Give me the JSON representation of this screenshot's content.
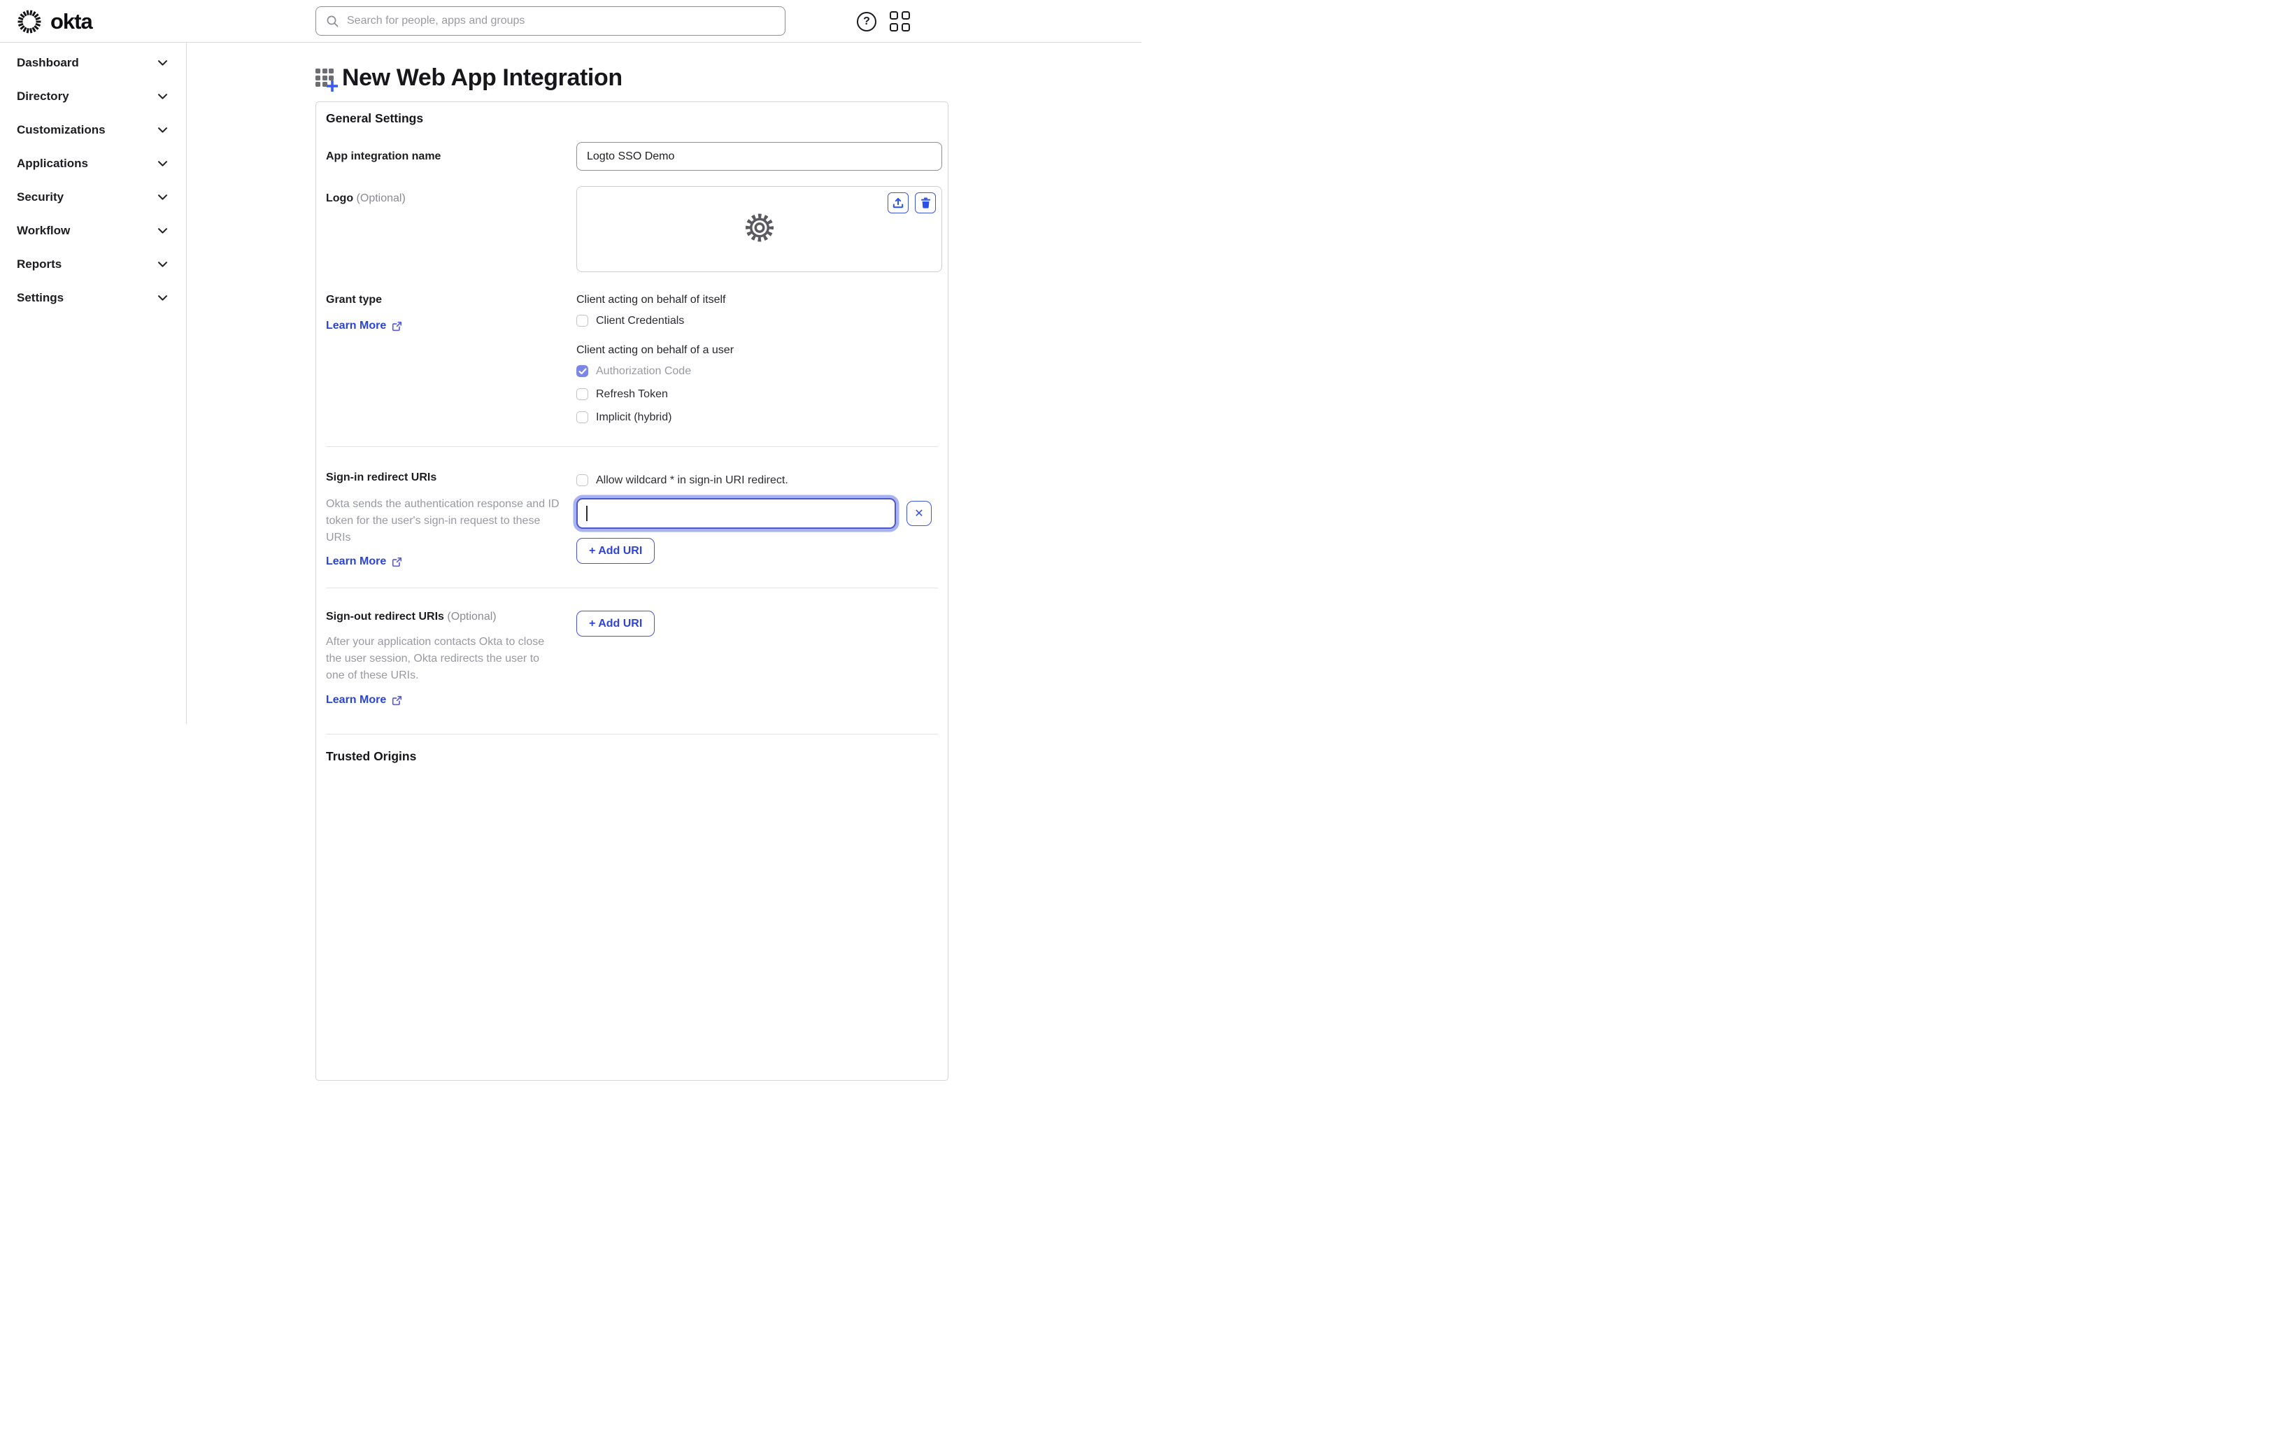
{
  "header": {
    "brand": "okta",
    "search": {
      "placeholder": "Search for people, apps and groups"
    },
    "help_glyph": "?"
  },
  "sidebar": {
    "items": [
      {
        "label": "Dashboard"
      },
      {
        "label": "Directory"
      },
      {
        "label": "Customizations"
      },
      {
        "label": "Applications"
      },
      {
        "label": "Security"
      },
      {
        "label": "Workflow"
      },
      {
        "label": "Reports"
      },
      {
        "label": "Settings"
      }
    ]
  },
  "page": {
    "title": "New Web App Integration"
  },
  "general": {
    "heading": "General Settings",
    "app_name": {
      "label": "App integration name",
      "value": "Logto SSO Demo"
    },
    "logo": {
      "label": "Logo",
      "optional": "(Optional)"
    },
    "grant": {
      "label": "Grant type",
      "learn_more": "Learn More",
      "group_itself": "Client acting on behalf of itself",
      "group_user": "Client acting on behalf of a user",
      "options": [
        {
          "label": "Client Credentials",
          "checked": false
        },
        {
          "label": "Authorization Code",
          "checked": true,
          "disabled": true
        },
        {
          "label": "Refresh Token",
          "checked": false
        },
        {
          "label": "Implicit (hybrid)",
          "checked": false
        }
      ]
    },
    "signin": {
      "label": "Sign-in redirect URIs",
      "wildcard_label": "Allow wildcard * in sign-in URI redirect.",
      "wildcard_checked": false,
      "helper": "Okta sends the authentication response and ID token for the user's sign-in request to these URIs",
      "learn_more": "Learn More",
      "uri_value": "",
      "uri_focused": true,
      "add_uri": "+ Add URI",
      "remove_glyph": "✕"
    },
    "signout": {
      "label": "Sign-out redirect URIs",
      "optional": "(Optional)",
      "helper": "After your application contacts Okta to close the user session, Okta redirects the user to one of these URIs.",
      "learn_more": "Learn More",
      "add_uri": "+ Add URI"
    },
    "trusted_heading": "Trusted Origins"
  },
  "colors": {
    "accent_border_blue": "#4156de",
    "link_blue": "#2b44d8",
    "icon_blue": "#2b52e9",
    "checkbox_checked_fill": "#7b87e8",
    "text_primary": "#1d1d21",
    "text_muted": "#989aa3",
    "divider": "#e3e3e7"
  }
}
